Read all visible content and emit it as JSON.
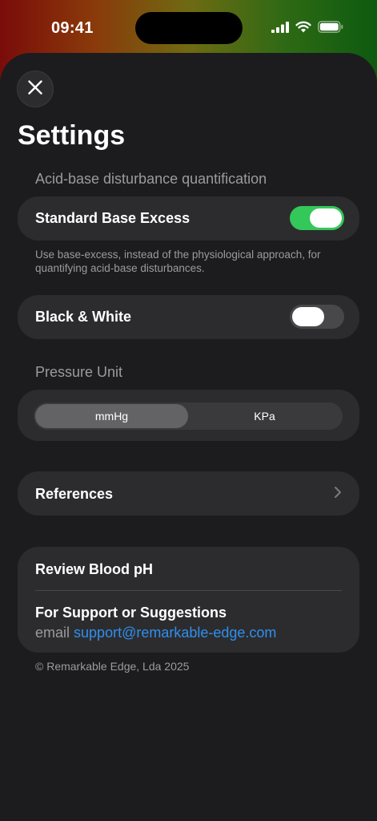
{
  "status_bar": {
    "time": "09:41"
  },
  "sheet": {
    "title": "Settings"
  },
  "acid_base": {
    "section_label": "Acid-base disturbance quantification",
    "standard_base_excess": {
      "label": "Standard Base Excess",
      "enabled": true
    },
    "footnote": "Use base-excess, instead of the physiological approach, for quantifying acid-base disturbances."
  },
  "black_white": {
    "label": "Black & White",
    "enabled": false
  },
  "pressure_unit": {
    "section_label": "Pressure Unit",
    "options": [
      "mmHg",
      "KPa"
    ],
    "selected": "mmHg"
  },
  "references": {
    "label": "References"
  },
  "support": {
    "review_label": "Review Blood pH",
    "heading": "For Support or Suggestions",
    "email_prefix": "email",
    "email": "support@remarkable-edge.com"
  },
  "copyright": "© Remarkable Edge, Lda 2025",
  "colors": {
    "accent": "#34c759",
    "link": "#2f8ff0",
    "background": "#1c1c1e",
    "card": "#2c2c2e"
  },
  "icons": [
    "close-icon",
    "chevron-right-icon",
    "cellular-signal-icon",
    "wifi-icon",
    "battery-icon"
  ]
}
